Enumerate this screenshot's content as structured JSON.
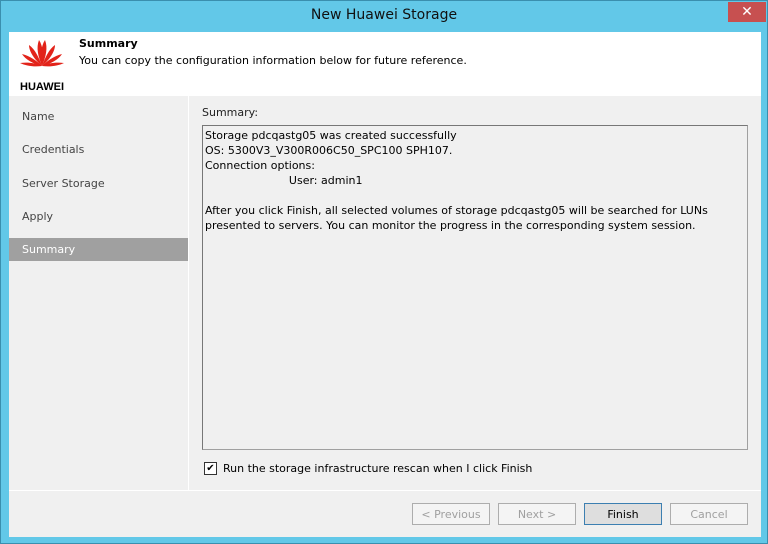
{
  "window": {
    "title": "New Huawei Storage",
    "close": "✕"
  },
  "header": {
    "logo_text": "HUAWEI",
    "title": "Summary",
    "subtitle": "You can copy the configuration information below for future reference."
  },
  "nav": {
    "items": [
      {
        "label": "Name"
      },
      {
        "label": "Credentials"
      },
      {
        "label": "Server Storage"
      },
      {
        "label": "Apply"
      },
      {
        "label": "Summary",
        "active": true
      }
    ]
  },
  "main": {
    "summary_label": "Summary:",
    "summary_text": "Storage pdcqastg05 was created successfully\nOS: 5300V3_V300R006C50_SPC100 SPH107.\nConnection options:\n                        User: admin1\n\nAfter you click Finish, all selected volumes of storage pdcqastg05 will be searched for LUNs presented to servers. You can monitor the progress in the corresponding system session.",
    "rescan_label": "Run the storage infrastructure rescan when I click Finish",
    "rescan_checked": true
  },
  "buttons": {
    "previous": "< Previous",
    "next": "Next >",
    "finish": "Finish",
    "cancel": "Cancel"
  }
}
